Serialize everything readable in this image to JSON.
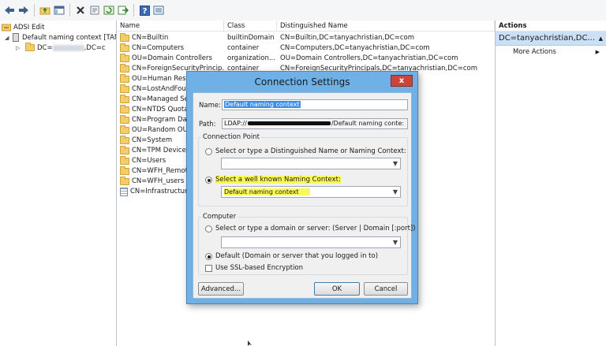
{
  "toolbar": {
    "icons": [
      "back-arrow-icon",
      "forward-arrow-icon",
      "up-folder-icon",
      "show-hide-tree-icon",
      "delete-icon",
      "properties-icon",
      "refresh-icon",
      "export-icon",
      "help-icon",
      "view-icon"
    ]
  },
  "tree": {
    "root": "ADSI Edit",
    "context": "Default naming context [TAN",
    "dc_prefix": "DC=",
    "dc_suffix": ",DC=c"
  },
  "list": {
    "columns": [
      "Name",
      "Class",
      "Distinguished Name"
    ],
    "rows": [
      {
        "name": "CN=Builtin",
        "cls": "builtinDomain",
        "dn": "CN=Builtin,DC=tanyachristian,DC=com"
      },
      {
        "name": "CN=Computers",
        "cls": "container",
        "dn": "CN=Computers,DC=tanyachristian,DC=com"
      },
      {
        "name": "OU=Domain Controllers",
        "cls": "organization...",
        "dn": "OU=Domain Controllers,DC=tanyachristian,DC=com"
      },
      {
        "name": "CN=ForeignSecurityPrincip...",
        "cls": "container",
        "dn": "CN=ForeignSecurityPrincipals,DC=tanyachristian,DC=com"
      },
      {
        "name": "OU=Human Reso",
        "cls": "",
        "dn": "C=com"
      },
      {
        "name": "CN=LostAndFour",
        "cls": "",
        "dn": "om"
      },
      {
        "name": "CN=Managed Se",
        "cls": "",
        "dn": "hristian,DC=com"
      },
      {
        "name": "CN=NTDS Quota",
        "cls": "",
        "dn": "om"
      },
      {
        "name": "CN=Program Dat",
        "cls": "",
        "dn": "om"
      },
      {
        "name": "OU=Random OU",
        "cls": "",
        "dn": "om"
      },
      {
        "name": "CN=System",
        "cls": "",
        "dn": ""
      },
      {
        "name": "CN=TPM Devices",
        "cls": "",
        "dn": "om"
      },
      {
        "name": "CN=Users",
        "cls": "",
        "dn": ""
      },
      {
        "name": "CN=WFH_Remot",
        "cls": "",
        "dn": "DC=com"
      },
      {
        "name": "CN=WFH_users",
        "cls": "",
        "dn": "om"
      },
      {
        "name": "CN=Infrastructur",
        "cls": "",
        "dn": "om"
      }
    ]
  },
  "actions": {
    "header": "Actions",
    "selected": "DC=tanyachristian,DC...",
    "more": "More Actions"
  },
  "dialog": {
    "title": "Connection Settings",
    "close_label": "x",
    "name_label": "Name:",
    "name_value": "Default naming context",
    "path_label": "Path:",
    "path_prefix": "LDAP://",
    "path_suffix": "/Default naming conte:",
    "connection_point_title": "Connection Point",
    "radio_dn_label": "Select or type a Distinguished Name or Naming Context:",
    "radio_known_label": "Select a well known Naming Context:",
    "known_value": "Default naming context",
    "computer_title": "Computer",
    "radio_server_label": "Select or type a domain or server: (Server | Domain [:port])",
    "radio_default_label": "Default (Domain or server that you logged in to)",
    "ssl_label": "Use SSL-based Encryption",
    "advanced_label": "Advanced...",
    "ok_label": "OK",
    "cancel_label": "Cancel"
  },
  "colors": {
    "dialog_frame": "#6fb1e6",
    "highlight": "#fbf95a",
    "selection": "#cbe0f7"
  }
}
